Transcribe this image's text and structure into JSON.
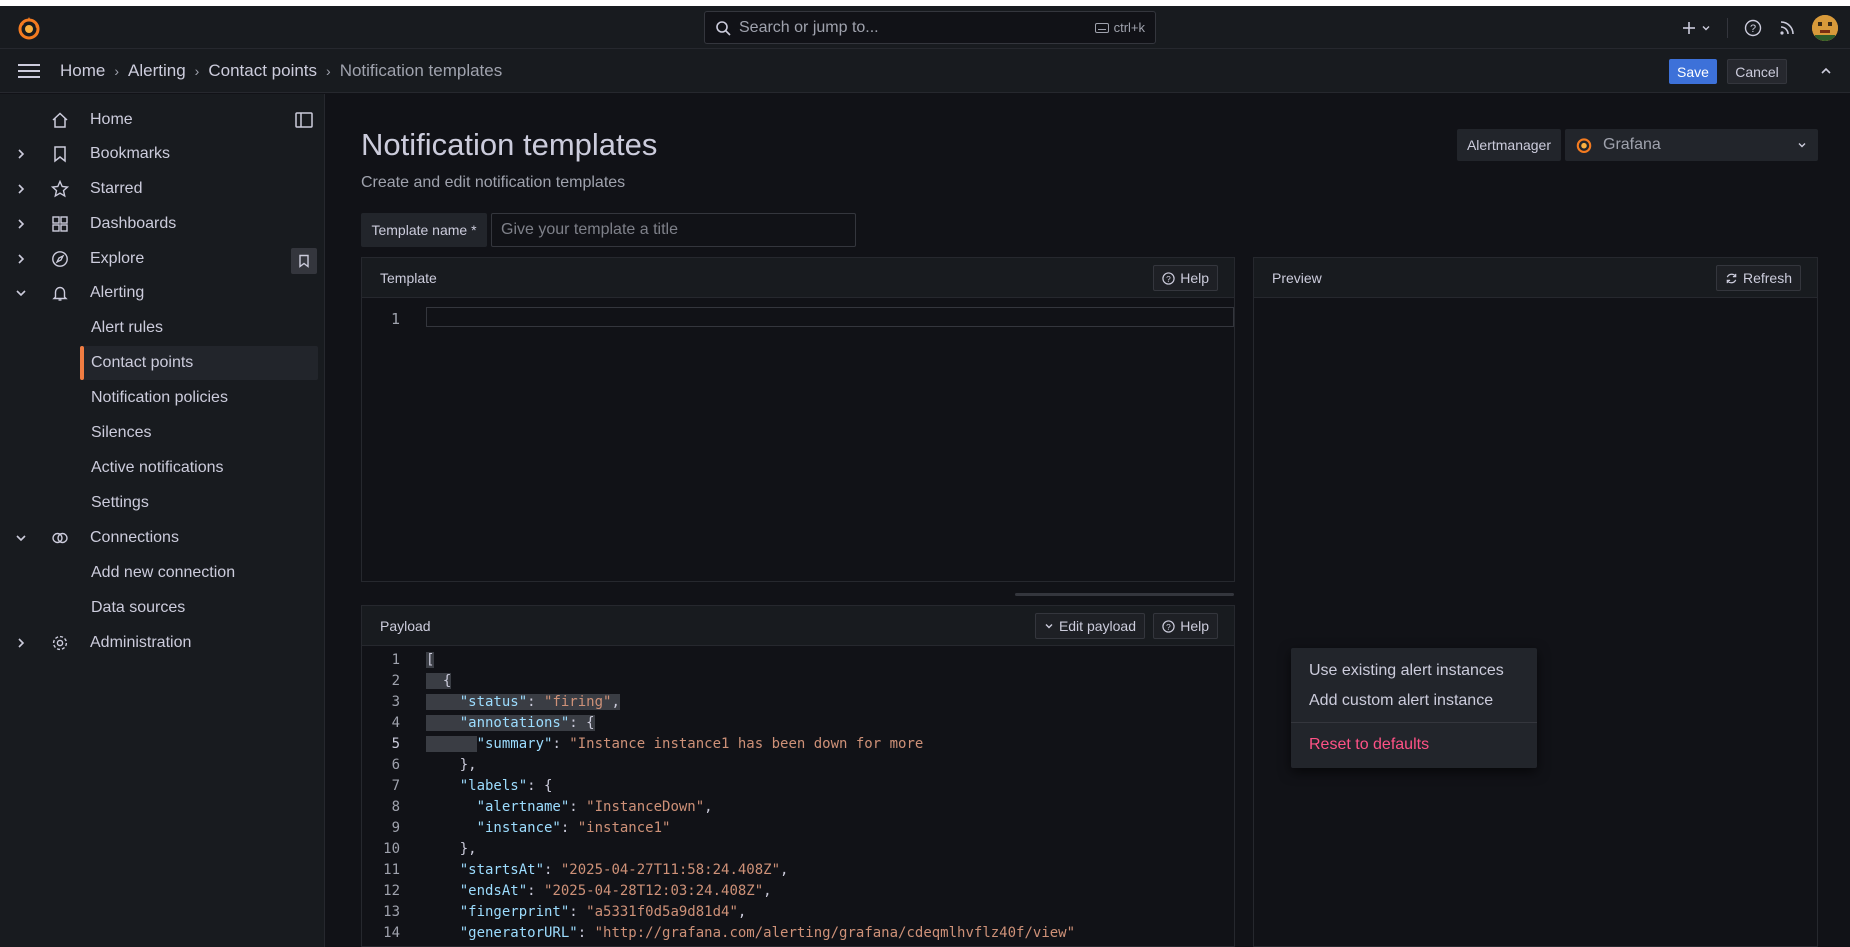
{
  "search": {
    "placeholder": "Search or jump to...",
    "shortcut": "ctrl+k"
  },
  "breadcrumbs": [
    "Home",
    "Alerting",
    "Contact points",
    "Notification templates"
  ],
  "actions": {
    "save": "Save",
    "cancel": "Cancel"
  },
  "sidebar": {
    "items": [
      {
        "label": "Home",
        "icon": "home-icon"
      },
      {
        "label": "Bookmarks",
        "icon": "bookmark-icon"
      },
      {
        "label": "Starred",
        "icon": "star-icon"
      },
      {
        "label": "Dashboards",
        "icon": "apps-icon"
      },
      {
        "label": "Explore",
        "icon": "compass-icon"
      },
      {
        "label": "Alerting",
        "icon": "bell-icon"
      },
      {
        "label": "Connections",
        "icon": "link-icon"
      },
      {
        "label": "Administration",
        "icon": "cog-icon"
      }
    ],
    "alerting_children": [
      "Alert rules",
      "Contact points",
      "Notification policies",
      "Silences",
      "Active notifications",
      "Settings"
    ],
    "connections_children": [
      "Add new connection",
      "Data sources"
    ],
    "active": "Contact points"
  },
  "page": {
    "title": "Notification templates",
    "subtitle": "Create and edit notification templates",
    "alertmanager_label": "Alertmanager",
    "alertmanager_value": "Grafana",
    "template_name_label": "Template name *",
    "template_name_placeholder": "Give your template a title",
    "template_name_value": ""
  },
  "template_panel": {
    "title": "Template",
    "help": "Help",
    "line_numbers": [
      "1"
    ]
  },
  "preview_panel": {
    "title": "Preview",
    "refresh": "Refresh"
  },
  "payload_panel": {
    "title": "Payload",
    "edit_payload": "Edit payload",
    "help": "Help",
    "line_numbers": [
      "1",
      "2",
      "3",
      "4",
      "5",
      "6",
      "7",
      "8",
      "9",
      "10",
      "11",
      "12",
      "13",
      "14"
    ],
    "code": {
      "l1": "[",
      "l2": "{",
      "l3_key": "\"status\"",
      "l3_val": "\"firing\"",
      "l4_key": "\"annotations\"",
      "l5_key": "\"summary\"",
      "l5_val": "\"Instance instance1 has been down for more",
      "l7_key": "\"labels\"",
      "l8_key": "\"alertname\"",
      "l8_val": "\"InstanceDown\"",
      "l9_key": "\"instance\"",
      "l9_val": "\"instance1\"",
      "l11_key": "\"startsAt\"",
      "l11_val": "\"2025-04-27T11:58:24.408Z\"",
      "l12_key": "\"endsAt\"",
      "l12_val": "\"2025-04-28T12:03:24.408Z\"",
      "l13_key": "\"fingerprint\"",
      "l13_val": "\"a5331f0d5a9d81d4\"",
      "l14_key": "\"generatorURL\"",
      "l14_val": "\"http://grafana.com/alerting/grafana/cdeqmlhvflz40f/view\""
    }
  },
  "payload_menu": {
    "items": [
      "Use existing alert instances",
      "Add custom alert instance"
    ],
    "danger": "Reset to defaults"
  },
  "colors": {
    "accent": "#f17d42",
    "primary": "#3d71d9",
    "danger": "#ff5286",
    "json_key": "#9cdcfe",
    "json_string": "#ce9178"
  }
}
